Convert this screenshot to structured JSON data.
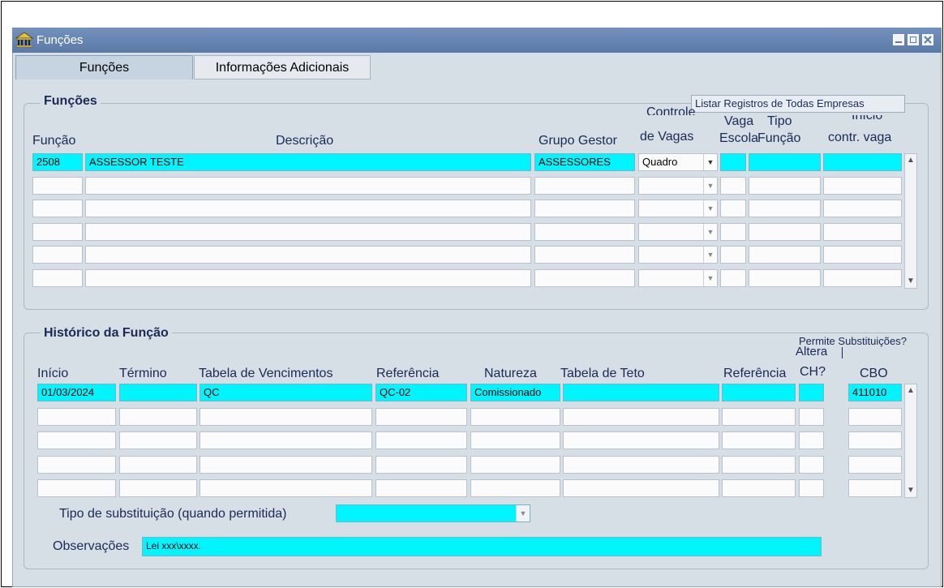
{
  "window": {
    "title": "Funções"
  },
  "tabs": [
    {
      "label": "Funções"
    },
    {
      "label": "Informações Adicionais"
    }
  ],
  "tooltip": "Listar Registros de Todas Empresas",
  "funcoes": {
    "section_title": "Funções",
    "headers": {
      "funcao": "Função",
      "descricao": "Descrição",
      "grupo_gestor": "Grupo Gestor",
      "controle_vagas_1": "Controle",
      "controle_vagas_2": "de Vagas",
      "vaga_escola_1": "Vaga",
      "vaga_escola_2": "Escola",
      "tipo_funcao_1": "Tipo",
      "tipo_funcao_2": "Função",
      "inicio_contr_1": "Início",
      "inicio_contr_2": "contr. vaga"
    },
    "rows": [
      {
        "funcao": "2508",
        "descricao": "ASSESSOR TESTE",
        "grupo_gestor": "ASSESSORES",
        "controle": "Quadro",
        "vaga_escola": "",
        "tipo_funcao": "",
        "inicio_contr": ""
      },
      {
        "funcao": "",
        "descricao": "",
        "grupo_gestor": "",
        "controle": "",
        "vaga_escola": "",
        "tipo_funcao": "",
        "inicio_contr": ""
      },
      {
        "funcao": "",
        "descricao": "",
        "grupo_gestor": "",
        "controle": "",
        "vaga_escola": "",
        "tipo_funcao": "",
        "inicio_contr": ""
      },
      {
        "funcao": "",
        "descricao": "",
        "grupo_gestor": "",
        "controle": "",
        "vaga_escola": "",
        "tipo_funcao": "",
        "inicio_contr": ""
      },
      {
        "funcao": "",
        "descricao": "",
        "grupo_gestor": "",
        "controle": "",
        "vaga_escola": "",
        "tipo_funcao": "",
        "inicio_contr": ""
      },
      {
        "funcao": "",
        "descricao": "",
        "grupo_gestor": "",
        "controle": "",
        "vaga_escola": "",
        "tipo_funcao": "",
        "inicio_contr": ""
      }
    ]
  },
  "historico": {
    "section_title": "Histórico da Função",
    "headers": {
      "inicio": "Início",
      "termino": "Término",
      "tabela_vencimentos": "Tabela de Vencimentos",
      "referencia": "Referência",
      "natureza": "Natureza",
      "tabela_teto": "Tabela de Teto",
      "referencia2": "Referência",
      "altera_ch_1": "Altera",
      "altera_ch_2": "CH?",
      "permite_subst": "Permite Substituições?",
      "cbo": "CBO"
    },
    "rows": [
      {
        "inicio": "01/03/2024",
        "termino": "",
        "tabela_vencimentos": "QC",
        "referencia": "QC-02",
        "natureza": "Comissionado",
        "tabela_teto": "",
        "referencia2": "",
        "altera_ch": "",
        "cbo": "411010"
      },
      {
        "inicio": "",
        "termino": "",
        "tabela_vencimentos": "",
        "referencia": "",
        "natureza": "",
        "tabela_teto": "",
        "referencia2": "",
        "altera_ch": "",
        "cbo": ""
      },
      {
        "inicio": "",
        "termino": "",
        "tabela_vencimentos": "",
        "referencia": "",
        "natureza": "",
        "tabela_teto": "",
        "referencia2": "",
        "altera_ch": "",
        "cbo": ""
      },
      {
        "inicio": "",
        "termino": "",
        "tabela_vencimentos": "",
        "referencia": "",
        "natureza": "",
        "tabela_teto": "",
        "referencia2": "",
        "altera_ch": "",
        "cbo": ""
      },
      {
        "inicio": "",
        "termino": "",
        "tabela_vencimentos": "",
        "referencia": "",
        "natureza": "",
        "tabela_teto": "",
        "referencia2": "",
        "altera_ch": "",
        "cbo": ""
      }
    ],
    "tipo_substituicao_label": "Tipo de substituição (quando permitida)",
    "tipo_substituicao_value": "",
    "observacoes_label": "Observações",
    "observacoes_value": "Lei xxx\\xxxx."
  },
  "colors": {
    "active_field": "#00f5ff",
    "canvas": "#d6dee6",
    "titlebar": "#5b7aa8",
    "label": "#1a2a55"
  }
}
